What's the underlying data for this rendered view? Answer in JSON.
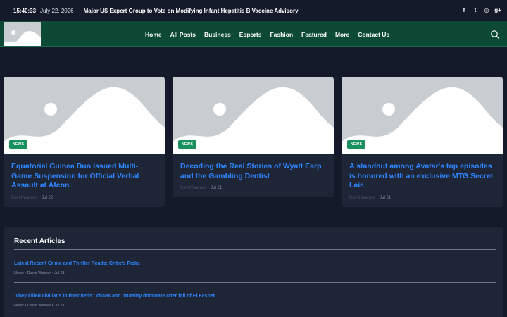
{
  "topbar": {
    "time": "15:40:33",
    "date": "July 22, 2026",
    "ticker": "Major US Expert Group to Vote on Modifying Infant Hepatitis B Vaccine Advisory",
    "social": [
      {
        "glyph": "f",
        "icon": "facebook-icon"
      },
      {
        "glyph": "t",
        "icon": "twitter-icon"
      },
      {
        "glyph": "◎",
        "icon": "instagram-icon"
      },
      {
        "glyph": "g+",
        "icon": "google-plus-icon"
      }
    ]
  },
  "nav": {
    "items": [
      "Home",
      "All Posts",
      "Business",
      "Esports",
      "Fashion",
      "Featured",
      "More",
      "Contact Us"
    ],
    "search_icon": "search-icon"
  },
  "cards": [
    {
      "badge": "NEWS",
      "title": "Equatorial Guinea Duo Issued Multi-Game Suspension for Official Verbal Assault at Afcon.",
      "author": "David Warner",
      "date": "Jul 22"
    },
    {
      "badge": "NEWS",
      "title": "Decoding the Real Stories of Wyatt Earp and the Gambling Dentist",
      "author": "David Warner",
      "date": "Jul 21"
    },
    {
      "badge": "NEWS",
      "title": "A standout among Avatar's top episodes is honored with an exclusive MTG Secret Lair.",
      "author": "David Warner",
      "date": "Jul 21"
    }
  ],
  "recent": {
    "heading": "Recent Articles",
    "items": [
      {
        "title": "Latest Recent Crime and Thriller Reads: Critic's Picks",
        "meta": "News • David Warner • Jul 21"
      },
      {
        "title": "'They killed civilians in their beds': chaos and brutality dominate after fall of El Fasher",
        "meta": "News • David Warner • Jul 21"
      }
    ]
  },
  "colors": {
    "page_bg": "#141a2a",
    "nav_bg": "#0d4a35",
    "card_bg": "#1e2536",
    "link": "#2e86ff",
    "badge": "#18915f",
    "placeholder": "#c8cdd2"
  }
}
